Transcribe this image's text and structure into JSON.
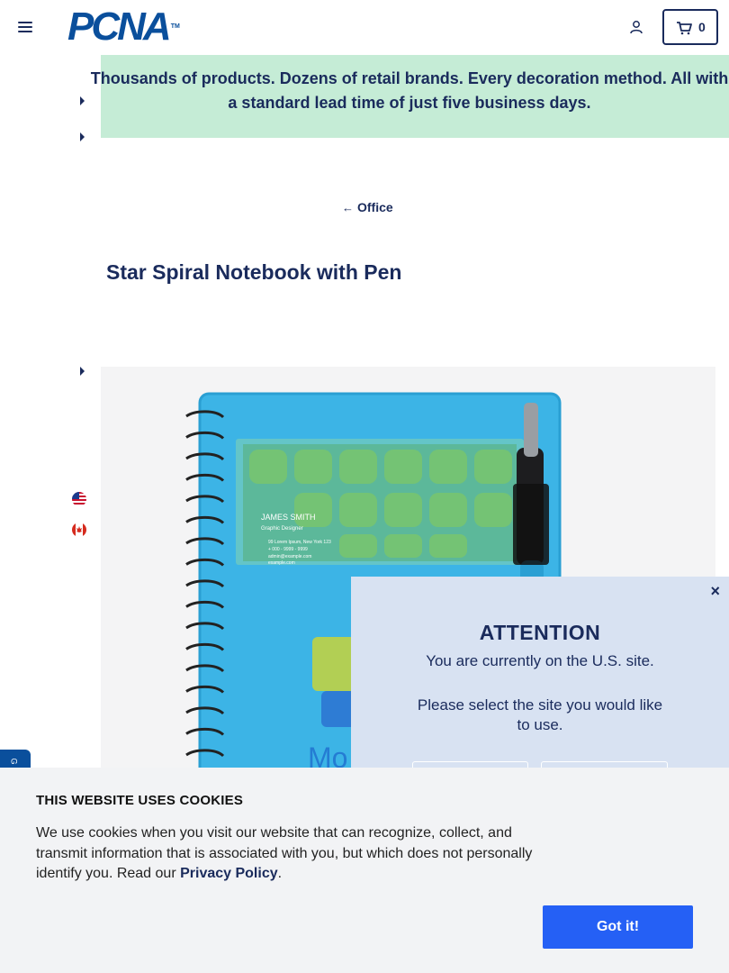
{
  "header": {
    "logo_text": "PCNA",
    "logo_tm": "TM",
    "cart_count": "0"
  },
  "banner": {
    "text": "Thousands of products. Dozens of retail brands. Every decoration method. All with a standard lead time of just five business days."
  },
  "breadcrumb": {
    "back_label": "Office"
  },
  "product": {
    "title": "Star Spiral Notebook with Pen",
    "image": {
      "card_name": "JAMES SMITH",
      "card_role": "Graphic Designer",
      "card_lines": [
        "99 Lorem Ipsum, New York 123",
        "+ 000 - 9999 - 9999",
        "admin@example.com",
        "example.com"
      ]
    }
  },
  "modal": {
    "close": "×",
    "title": "ATTENTION",
    "line1": "You are currently on the U.S. site.",
    "line2": "Please select the site you would like to use."
  },
  "side_tab": {
    "label": "G"
  },
  "cookie": {
    "title": "THIS WEBSITE USES COOKIES",
    "text_before": "We use cookies when you visit our website that can recognize, collect, and transmit information that is associated with you, but which does not personally identify you. Read our ",
    "link_label": "Privacy Policy",
    "text_after": ".",
    "button_label": "Got it!"
  },
  "colors": {
    "navy": "#1a2b5c",
    "brand_blue": "#0a4f9c",
    "banner_green": "#c5ecd6",
    "modal_bg": "#d8e2f2",
    "cookie_button": "#2560f5"
  },
  "icons": [
    "menu-icon",
    "user-icon",
    "cart-icon",
    "arrow-left-icon",
    "caret-right-icon",
    "us-flag-icon",
    "canada-flag-icon",
    "close-icon"
  ]
}
